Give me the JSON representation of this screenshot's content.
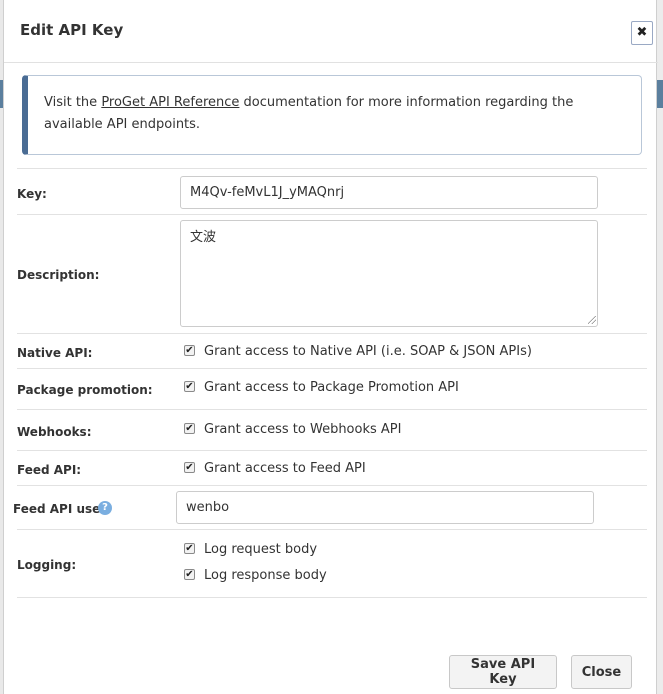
{
  "dialog": {
    "title": "Edit API Key",
    "close_symbol": "✖"
  },
  "info": {
    "prefix": "Visit the ",
    "link_text": "ProGet API Reference",
    "suffix": " documentation for more information regarding the available API endpoints."
  },
  "form": {
    "key": {
      "label": "Key:",
      "value": "M4Qv-feMvL1J_yMAQnrj"
    },
    "description": {
      "label": "Description:",
      "value": "文波"
    },
    "native_api": {
      "label": "Native API:",
      "checkbox_label": "Grant access to Native API (i.e. SOAP & JSON APIs)",
      "checked": true
    },
    "package_promotion": {
      "label": "Package promotion:",
      "checkbox_label": "Grant access to Package Promotion API",
      "checked": true
    },
    "webhooks": {
      "label": "Webhooks:",
      "checkbox_label": "Grant access to Webhooks API",
      "checked": true
    },
    "feed_api": {
      "label": "Feed API:",
      "checkbox_label": "Grant access to Feed API",
      "checked": true
    },
    "feed_api_user": {
      "label": "Feed API user:",
      "help_symbol": "?",
      "value": "wenbo"
    },
    "logging": {
      "label": "Logging:",
      "request_label": "Log request body",
      "request_checked": true,
      "response_label": "Log response body",
      "response_checked": true
    }
  },
  "buttons": {
    "save": "Save API Key",
    "close": "Close"
  },
  "theme": {
    "accent": "#4a6c94",
    "info_border": "#b9c7d8",
    "help_icon": "#7aaee0",
    "close_button_border": "#9aa9c4"
  },
  "check_mark": "✔"
}
